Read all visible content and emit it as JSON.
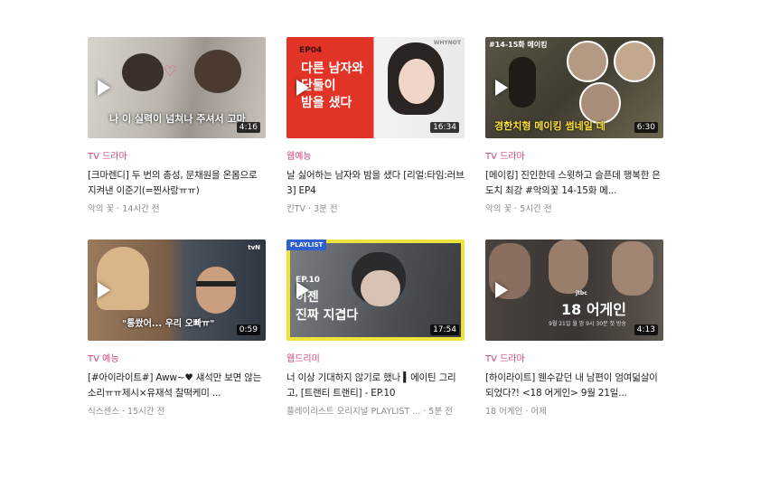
{
  "videos": [
    {
      "category": "TV 드라마",
      "title": "[크마렌디] 두 번의 총성, 문채원을 온몸으로 지켜낸 이준기(=찐사랑ㅠㅠ)",
      "meta": "악의 꽃 · 14시간 전",
      "duration": "4:16",
      "thumb_text": "나 이 실력이 넘쳐나 주셔서 고마",
      "colors": [
        "#c9c4bd",
        "#8f8a83"
      ]
    },
    {
      "category": "웹예능",
      "title": "날 싫어하는 남자와 밤을 샜다 [리얼:타임:러브 3] EP4",
      "meta": "킨TV · 3분 전",
      "duration": "16:34",
      "thumb_tag": "EP04",
      "thumb_lines": [
        "다른 남자와",
        "단둘이",
        "밤을 샜다"
      ],
      "thumb_badge": "WHYNOT",
      "colors": [
        "#e23327",
        "#f2f2f2"
      ]
    },
    {
      "category": "TV 드라마",
      "title": "[메이킹] 진인한데 스윗하고 슬픈데 행복한 은 도치 최강 #악의꽃 14-15화 메...",
      "meta": "악의 꽃 · 5시간 전",
      "duration": "6:30",
      "thumb_tag": "#14-15화 메이킹",
      "thumb_lines": [
        "경한치형 메이킹 썸네일 데"
      ],
      "colors": [
        "#4a4638",
        "#7b7460"
      ]
    },
    {
      "category": "TV 예능",
      "title": "[#아이라이트#] Aww~♥ 섀석만 보면 않는 소리ㅠㅠ제시×유재석 찰떡케미 ...",
      "meta": "식스센스 · 15시간 전",
      "duration": "0:59",
      "thumb_text": "\"통쐈어... 우리 오빠ㅠ\"",
      "thumb_badge": "tvN",
      "colors": [
        "#8a6a4e",
        "#3d4550"
      ]
    },
    {
      "category": "웹드리미",
      "title": "너 이상 기대하지 않기로 했나 ▍에이틴 그리고, [트랜티 트랜티] - EP.10",
      "meta": "플레이리스트 오리지널 PLAYLIST ... · 5분 전",
      "duration": "17:54",
      "thumb_tag": "PLAYLIST",
      "thumb_lines": [
        "EP.10",
        "이젠",
        "진짜 지겹다"
      ],
      "colors": [
        "#f0e23c",
        "#5b5f63"
      ]
    },
    {
      "category": "TV 드라마",
      "title": "[하이라이트] 웬수같던 내 남편이 엄여덟살이 되었다?! <18 어게인> 9월 21일...",
      "meta": "18 어게인 · 어제",
      "duration": "4:13",
      "thumb_lines": [
        "18 어게인"
      ],
      "thumb_badge": "jtbc",
      "thumb_sub": "9월 21일 월 밤 9시 30분 첫 방송",
      "colors": [
        "#3a3532",
        "#6f665d"
      ]
    }
  ]
}
